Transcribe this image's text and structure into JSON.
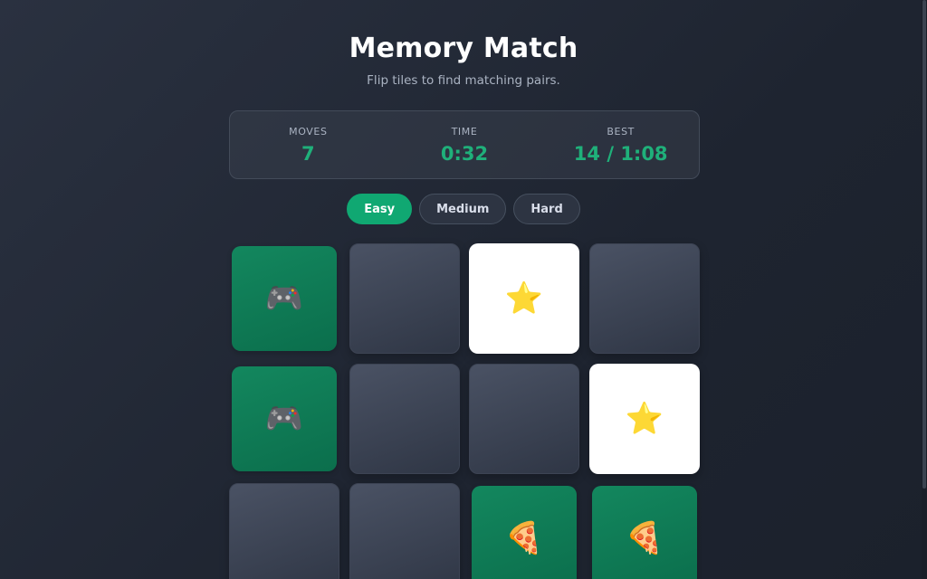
{
  "header": {
    "title": "Memory Match",
    "subtitle": "Flip tiles to find matching pairs."
  },
  "stats": [
    {
      "label": "MOVES",
      "value": "7"
    },
    {
      "label": "TIME",
      "value": "0:32"
    },
    {
      "label": "BEST",
      "value": "14 / 1:08"
    }
  ],
  "difficulty": {
    "options": [
      "Easy",
      "Medium",
      "Hard"
    ],
    "selected": "Easy"
  },
  "colors": {
    "accent": "#10a872",
    "stat_value": "#1fb07a",
    "matched_tile": "#0f7d57",
    "hidden_tile": "#3e4555",
    "flipped_tile": "#ffffff"
  },
  "board": {
    "columns": 4,
    "tiles": [
      {
        "state": "matched",
        "icon": "game-controller-icon",
        "glyph": "🎮"
      },
      {
        "state": "hidden",
        "icon": "",
        "glyph": ""
      },
      {
        "state": "flipped",
        "icon": "star-icon",
        "glyph": "⭐"
      },
      {
        "state": "hidden",
        "icon": "",
        "glyph": ""
      },
      {
        "state": "matched",
        "icon": "game-controller-icon",
        "glyph": "🎮"
      },
      {
        "state": "hidden",
        "icon": "",
        "glyph": ""
      },
      {
        "state": "hidden",
        "icon": "",
        "glyph": ""
      },
      {
        "state": "flipped",
        "icon": "star-icon",
        "glyph": "⭐"
      },
      {
        "state": "hidden",
        "icon": "",
        "glyph": ""
      },
      {
        "state": "hidden",
        "icon": "",
        "glyph": ""
      },
      {
        "state": "matched",
        "icon": "pizza-icon",
        "glyph": "🍕"
      },
      {
        "state": "matched",
        "icon": "pizza-icon",
        "glyph": "🍕"
      }
    ]
  }
}
